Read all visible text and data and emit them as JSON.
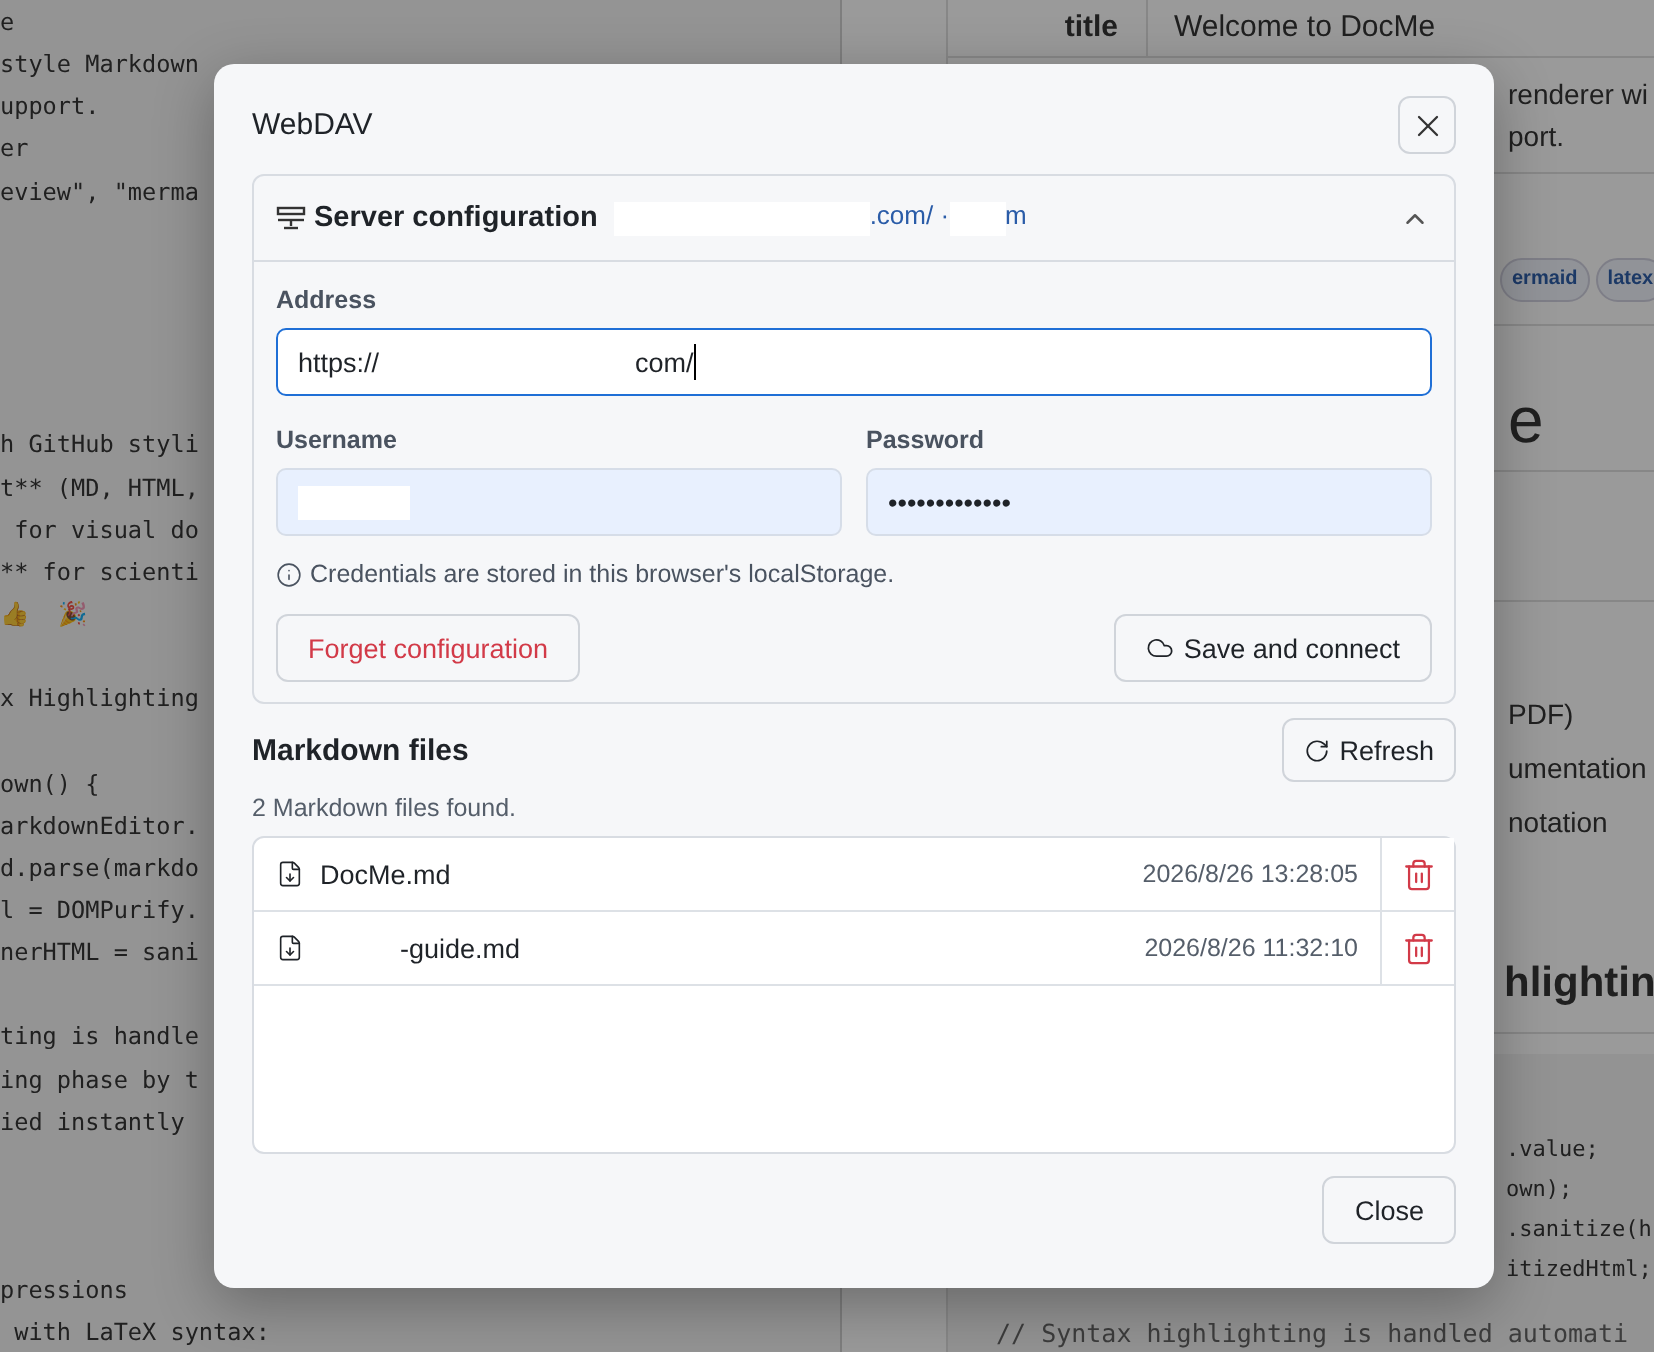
{
  "editor": {
    "lines": [
      {
        "kind": "code",
        "text": "e"
      },
      {
        "kind": "code",
        "text": "style Markdown"
      },
      {
        "kind": "code",
        "text": "upport."
      },
      {
        "kind": "code",
        "text": "er"
      },
      {
        "kind": "code",
        "text": "eview\", \"merma"
      },
      {
        "kind": "blank"
      },
      {
        "kind": "blank"
      },
      {
        "kind": "blank"
      },
      {
        "kind": "blank"
      },
      {
        "kind": "blank"
      },
      {
        "kind": "code",
        "text": "h GitHub styli"
      },
      {
        "kind": "code",
        "text": "t** (MD, HTML,"
      },
      {
        "kind": "code",
        "text": " for visual do"
      },
      {
        "kind": "code",
        "text": "** for scienti"
      },
      {
        "kind": "code",
        "text": "👍  🎉"
      },
      {
        "kind": "blank"
      },
      {
        "kind": "code",
        "text": "x Highlighting"
      },
      {
        "kind": "blank"
      },
      {
        "kind": "code",
        "text": "own() {"
      },
      {
        "kind": "code",
        "text": "arkdownEditor."
      },
      {
        "kind": "code",
        "text": "d.parse(markdo"
      },
      {
        "kind": "code",
        "text": "l = DOMPurify."
      },
      {
        "kind": "code",
        "text": "nerHTML = sani"
      },
      {
        "kind": "blank"
      },
      {
        "kind": "code",
        "text": "ting is handle"
      },
      {
        "kind": "code",
        "text": "ing phase by t"
      },
      {
        "kind": "code",
        "text": "ied instantly"
      },
      {
        "kind": "blank"
      },
      {
        "kind": "blank"
      },
      {
        "kind": "blank"
      },
      {
        "kind": "code",
        "text": "pressions"
      },
      {
        "kind": "code",
        "text": " with LaTeX syntax:"
      }
    ]
  },
  "preview": {
    "meta_key": "title",
    "meta_value": "Welcome to DocMe",
    "description_lines": [
      "renderer wi",
      "port."
    ],
    "tags": [
      "ermaid",
      "latex"
    ],
    "heading": "e",
    "list_items": [
      "PDF)",
      "umentation",
      "notation"
    ],
    "heading_2": "hlightin",
    "code_lines": [
      ".value;",
      "own);",
      ".sanitize(h",
      "itizedHtml;"
    ],
    "comment": "// Syntax highlighting is handled automati"
  },
  "dialog": {
    "title": "WebDAV",
    "server": {
      "title": "Server configuration",
      "expanded": true,
      "summary": [
        {
          "kind": "redacted"
        },
        {
          "kind": "text",
          "text": ".com/ ·"
        },
        {
          "kind": "redacted"
        },
        {
          "kind": "text",
          "text": "m"
        }
      ],
      "address": {
        "label": "Address",
        "focused": true,
        "value": [
          {
            "kind": "text",
            "text": "https://"
          },
          {
            "kind": "gap"
          },
          {
            "kind": "text",
            "text": "com/"
          }
        ]
      },
      "username": {
        "label": "Username",
        "focused": false,
        "value": [
          {
            "kind": "redacted"
          }
        ]
      },
      "password": {
        "label": "Password",
        "focused": false,
        "value": [
          {
            "kind": "text",
            "text": "•••••••••••••"
          }
        ]
      },
      "note": "Credentials are stored in this browser's localStorage.",
      "forget_button": "Forget configuration",
      "save_button": "Save and connect"
    },
    "files": {
      "title": "Markdown files",
      "refresh_button": "Refresh",
      "count": "2 Markdown files found.",
      "items": [
        {
          "name": [
            {
              "kind": "text",
              "text": "DocMe.md"
            }
          ],
          "modified": "2026/8/26 13:28:05"
        },
        {
          "name": [
            {
              "kind": "gap"
            },
            {
              "kind": "text",
              "text": "-guide.md"
            }
          ],
          "modified": "2026/8/26 11:32:10"
        }
      ]
    },
    "close_button": "Close"
  }
}
